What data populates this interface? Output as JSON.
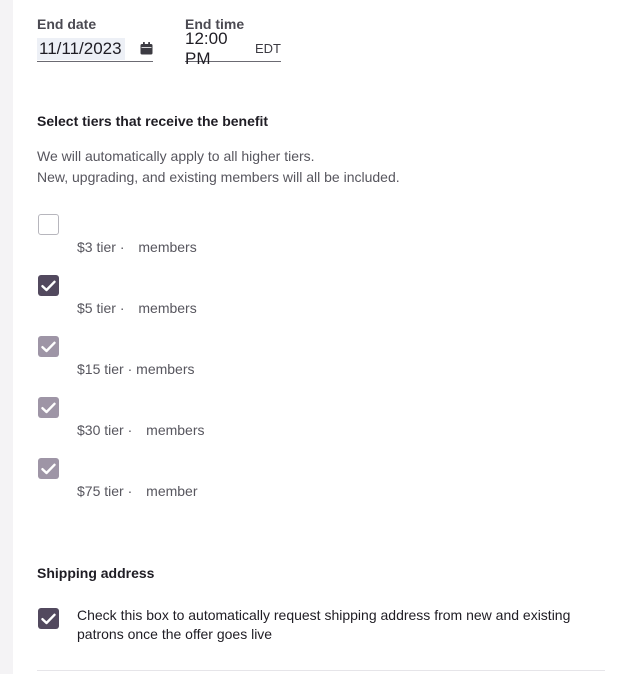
{
  "end_date": {
    "label": "End date",
    "value": "11/11/2023",
    "icon": "calendar-icon"
  },
  "end_time": {
    "label": "End time",
    "value": "12:00 PM",
    "timezone": "EDT"
  },
  "tiers_section": {
    "title": "Select tiers that receive the benefit",
    "helper_line1": "We will automatically apply to all higher tiers.",
    "helper_line2": "New, upgrading, and existing members will all be included.",
    "tiers": [
      {
        "name": "$3 tier",
        "sep": "·",
        "members_label": "members",
        "state": "unchecked"
      },
      {
        "name": "$5 tier",
        "sep": "·",
        "members_label": "members",
        "state": "checked"
      },
      {
        "name": "$15 tier",
        "sep": "·",
        "members_label": "members",
        "state": "checked-auto"
      },
      {
        "name": "$30 tier",
        "sep": "·",
        "members_label": "members",
        "state": "checked-auto"
      },
      {
        "name": "$75 tier",
        "sep": "·",
        "members_label": "member",
        "state": "checked-auto"
      }
    ]
  },
  "shipping": {
    "title": "Shipping address",
    "checkbox_label": "Check this box to automatically request shipping address from new and existing patrons once the offer goes live",
    "checked": true
  },
  "colors": {
    "checked_dark": "#52495e",
    "checked_muted": "#9e95a6",
    "text_primary": "#1f1d24",
    "text_secondary": "#57565e"
  }
}
